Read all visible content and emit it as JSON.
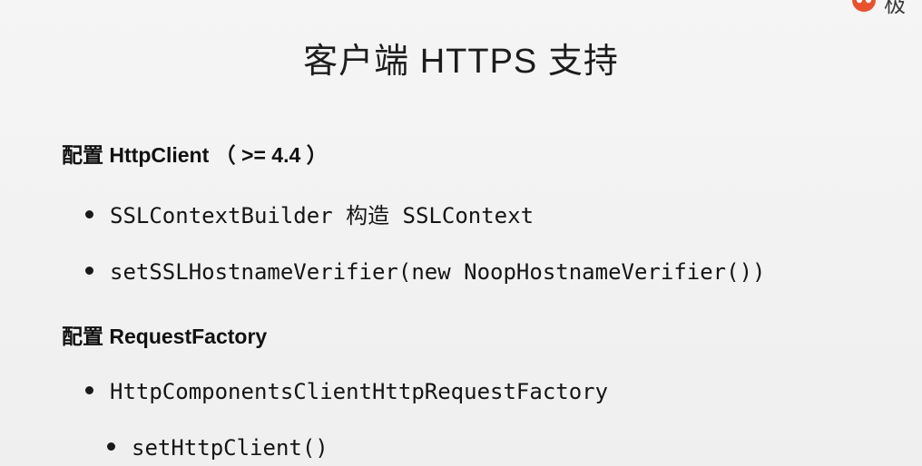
{
  "slide": {
    "title": "客户端 HTTPS 支持",
    "logo_text": "极",
    "sections": [
      {
        "heading": "配置 HttpClient （ >= 4.4 ）",
        "bullets": [
          "SSLContextBuilder 构造 SSLContext",
          "setSSLHostnameVerifier(new NoopHostnameVerifier())"
        ]
      },
      {
        "heading": "配置 RequestFactory",
        "bullets": [
          "HttpComponentsClientHttpRequestFactory",
          "setHttpClient()"
        ]
      }
    ]
  },
  "colors": {
    "background": "#f2f2f2",
    "text": "#1a1a1a",
    "logo_accent": "#e8522f"
  }
}
